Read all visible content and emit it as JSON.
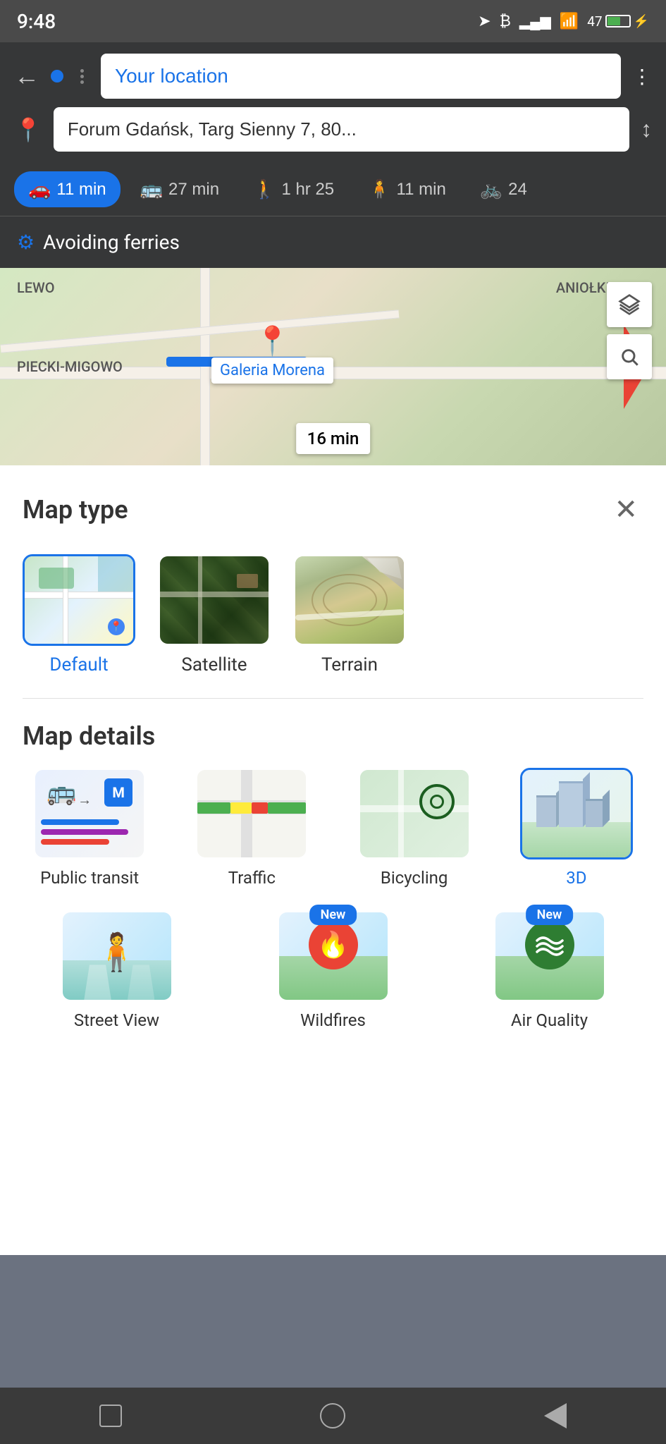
{
  "statusBar": {
    "time": "9:48",
    "battery": "47"
  },
  "navigation": {
    "from": "Your location",
    "to": "Forum Gdańsk, Targ Sienny 7, 80...",
    "backLabel": "←",
    "moreLabel": "⋮",
    "swapLabel": "↕"
  },
  "transportModes": [
    {
      "label": "11 min",
      "icon": "🚗",
      "active": true
    },
    {
      "label": "27 min",
      "icon": "🚌",
      "active": false
    },
    {
      "label": "1 hr 25",
      "icon": "🚶",
      "active": false
    },
    {
      "label": "11 min",
      "icon": "🧍",
      "active": false
    },
    {
      "label": "24",
      "icon": "🚲",
      "active": false
    }
  ],
  "avoidingRow": {
    "label": "Avoiding ferries",
    "icon": "⚙"
  },
  "map": {
    "placeLabel": "Galeria Morena",
    "timeLabel": "16 min",
    "areaLabels": [
      "LEWO",
      "ANIOŁKI",
      "PIECKI-MIGOWO"
    ]
  },
  "mapTypeSheet": {
    "title": "Map type",
    "closeLabel": "×",
    "types": [
      {
        "id": "default",
        "label": "Default",
        "selected": true
      },
      {
        "id": "satellite",
        "label": "Satellite",
        "selected": false
      },
      {
        "id": "terrain",
        "label": "Terrain",
        "selected": false
      }
    ]
  },
  "mapDetailsSection": {
    "title": "Map details",
    "row1": [
      {
        "id": "transit",
        "label": "Public transit",
        "selected": false
      },
      {
        "id": "traffic",
        "label": "Traffic",
        "selected": false
      },
      {
        "id": "bicycling",
        "label": "Bicycling",
        "selected": false
      },
      {
        "id": "3d",
        "label": "3D",
        "selected": true
      }
    ],
    "row2": [
      {
        "id": "streetview",
        "label": "Street View",
        "selected": false,
        "new": false
      },
      {
        "id": "wildfires",
        "label": "Wildfires",
        "selected": false,
        "new": true
      },
      {
        "id": "airquality",
        "label": "Air Quality",
        "selected": false,
        "new": true
      }
    ]
  },
  "systemNav": {
    "squareLabel": "□",
    "circleLabel": "○",
    "triangleLabel": "◁"
  }
}
